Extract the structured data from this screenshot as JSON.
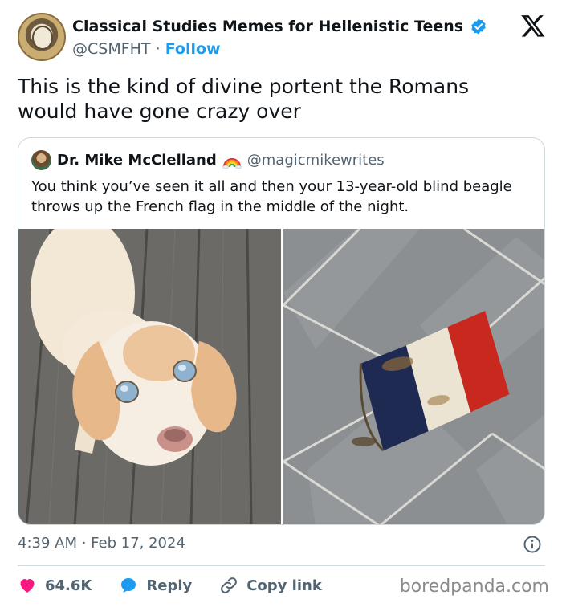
{
  "post": {
    "author_name": "Classical Studies Memes for Hellenistic Teens",
    "author_handle": "@CSMFHT",
    "separator": "·",
    "follow_label": "Follow",
    "text": "This is the kind of divine portent the Romans would have gone crazy over",
    "timestamp": "4:39 AM · Feb 17, 2024"
  },
  "quote": {
    "author_name": "Dr. Mike McClelland",
    "author_handle": "@magicmikewrites",
    "text": "You think you’ve seen it all and then your 13-year-old blind beagle throws up the French flag in the middle of the night."
  },
  "actions": {
    "likes_count": "64.6K",
    "reply_label": "Reply",
    "copy_link_label": "Copy link"
  },
  "watermark": "boredpanda.com",
  "colors": {
    "accent": "#1d9bf0",
    "like": "#f91880",
    "secondary_text": "#536471",
    "border": "#cfd9de"
  },
  "icons": [
    "x-logo-icon",
    "verified-badge-icon",
    "rainbow-emoji-icon",
    "info-icon",
    "heart-icon",
    "reply-bubble-icon",
    "link-icon"
  ]
}
